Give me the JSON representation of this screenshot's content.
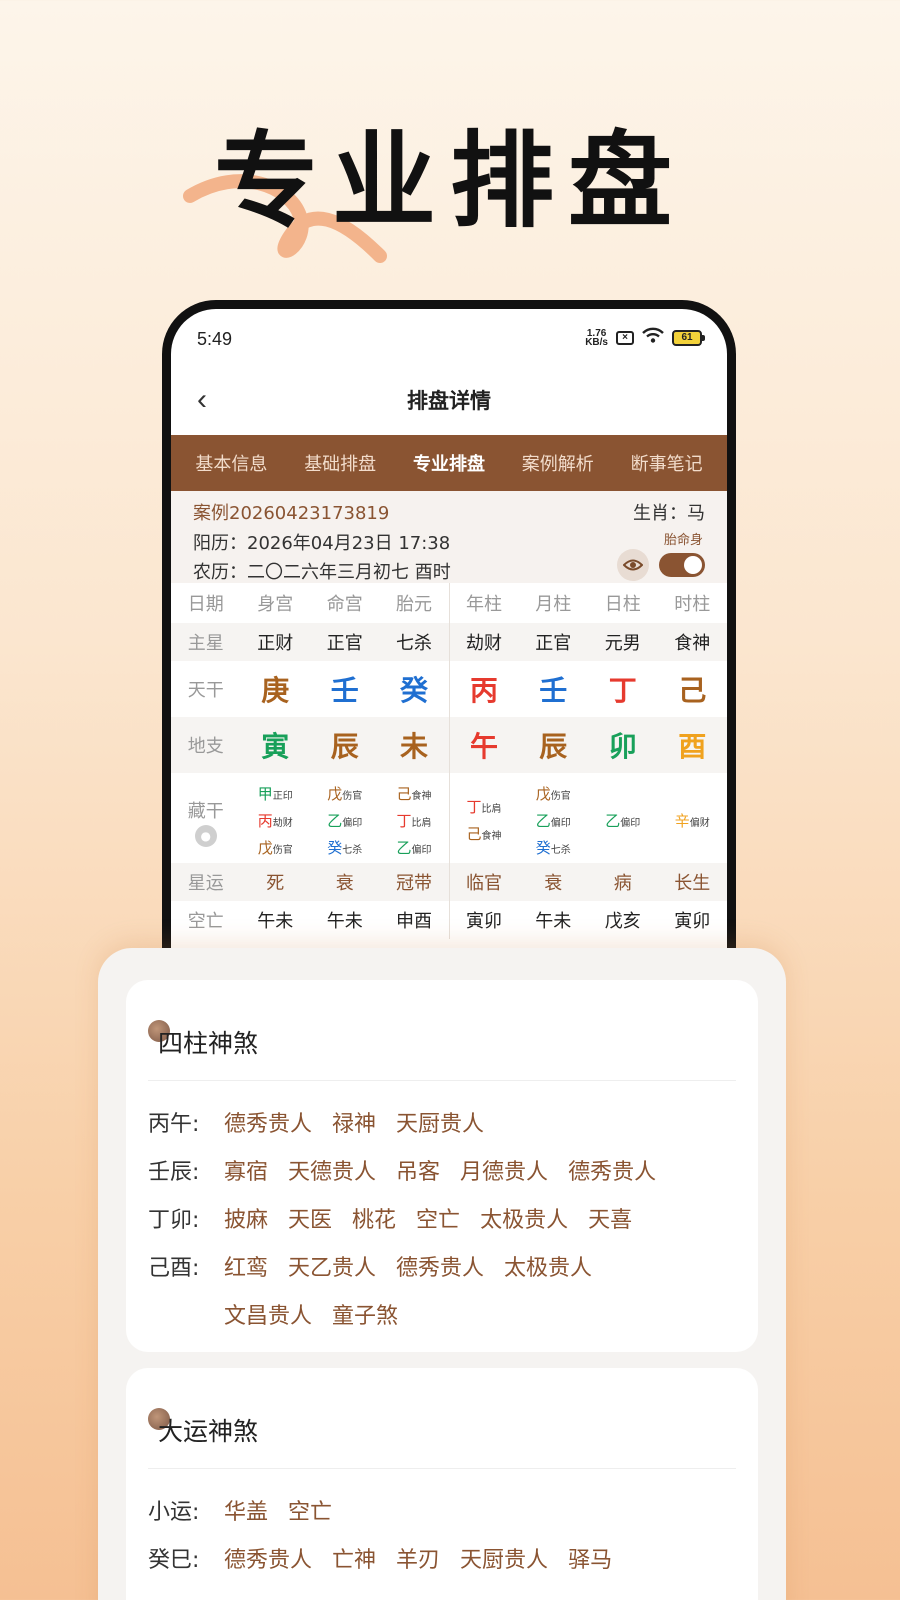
{
  "headline": "专业排盘",
  "status": {
    "time": "5:49",
    "net_speed_top": "1.76",
    "net_speed_bottom": "KB/s",
    "battery": "61"
  },
  "nav": {
    "title": "排盘详情"
  },
  "tabs": [
    "基本信息",
    "基础排盘",
    "专业排盘",
    "案例解析",
    "断事笔记"
  ],
  "case": {
    "id": "案例20260423173819",
    "zodiac": "生肖：马",
    "solar": "阳历：2026年04月23日 17:38",
    "lunar": "农历：二〇二六年三月初七 酉时",
    "toggle_label": "胎命身",
    "toggle_on": true
  },
  "grid": {
    "headers": [
      "日期",
      "身宫",
      "命宫",
      "胎元",
      "年柱",
      "月柱",
      "日柱",
      "时柱"
    ],
    "main_star_label": "主星",
    "main_star": [
      "正财",
      "正官",
      "七杀",
      "劫财",
      "正官",
      "元男",
      "食神"
    ],
    "gan_label": "天干",
    "gan": [
      "庚",
      "壬",
      "癸",
      "丙",
      "壬",
      "丁",
      "己"
    ],
    "zhi_label": "地支",
    "zhi": [
      "寅",
      "辰",
      "未",
      "午",
      "辰",
      "卯",
      "酉"
    ],
    "hidden_label": "藏干",
    "hidden": [
      [
        {
          "g": "甲",
          "t": "正印"
        },
        {
          "g": "丙",
          "t": "劫财"
        },
        {
          "g": "戊",
          "t": "伤官"
        }
      ],
      [
        {
          "g": "戊",
          "t": "伤官"
        },
        {
          "g": "乙",
          "t": "偏印"
        },
        {
          "g": "癸",
          "t": "七杀"
        }
      ],
      [
        {
          "g": "己",
          "t": "食神"
        },
        {
          "g": "丁",
          "t": "比肩"
        },
        {
          "g": "乙",
          "t": "偏印"
        }
      ],
      [
        {
          "g": "丁",
          "t": "比肩"
        },
        {
          "g": "己",
          "t": "食神"
        }
      ],
      [
        {
          "g": "戊",
          "t": "伤官"
        },
        {
          "g": "乙",
          "t": "偏印"
        },
        {
          "g": "癸",
          "t": "七杀"
        }
      ],
      [
        {
          "g": "乙",
          "t": "偏印"
        }
      ],
      [
        {
          "g": "辛",
          "t": "偏财"
        }
      ]
    ],
    "xingyun_label": "星运",
    "xingyun": [
      "死",
      "衰",
      "冠带",
      "临官",
      "衰",
      "病",
      "长生"
    ],
    "kongwang_label": "空亡",
    "kongwang": [
      "午未",
      "午未",
      "申酉",
      "寅卯",
      "午未",
      "戊亥",
      "寅卯"
    ]
  },
  "colors": {
    "wood": "#18a05a",
    "fire": "#e63a2e",
    "earth": "#a8621f",
    "metal": "#f0a21f",
    "water": "#1f6fd1",
    "brand_brown": "#8a5432"
  },
  "sizhu_shensha": {
    "title": "四柱神煞",
    "rows": [
      {
        "key": "丙午:",
        "vals": [
          "德秀贵人",
          "禄神",
          "天厨贵人"
        ]
      },
      {
        "key": "壬辰:",
        "vals": [
          "寡宿",
          "天德贵人",
          "吊客",
          "月德贵人",
          "德秀贵人"
        ]
      },
      {
        "key": "丁卯:",
        "vals": [
          "披麻",
          "天医",
          "桃花",
          "空亡",
          "太极贵人",
          "天喜"
        ]
      },
      {
        "key": "己酉:",
        "vals": [
          "红鸾",
          "天乙贵人",
          "德秀贵人",
          "太极贵人"
        ]
      }
    ],
    "continuation": [
      "文昌贵人",
      "童子煞"
    ]
  },
  "dayun_shensha": {
    "title": "大运神煞",
    "rows": [
      {
        "key": "小运:",
        "vals": [
          "华盖",
          "空亡"
        ]
      },
      {
        "key": "癸巳:",
        "vals": [
          "德秀贵人",
          "亡神",
          "羊刃",
          "天厨贵人",
          "驿马"
        ]
      }
    ]
  }
}
